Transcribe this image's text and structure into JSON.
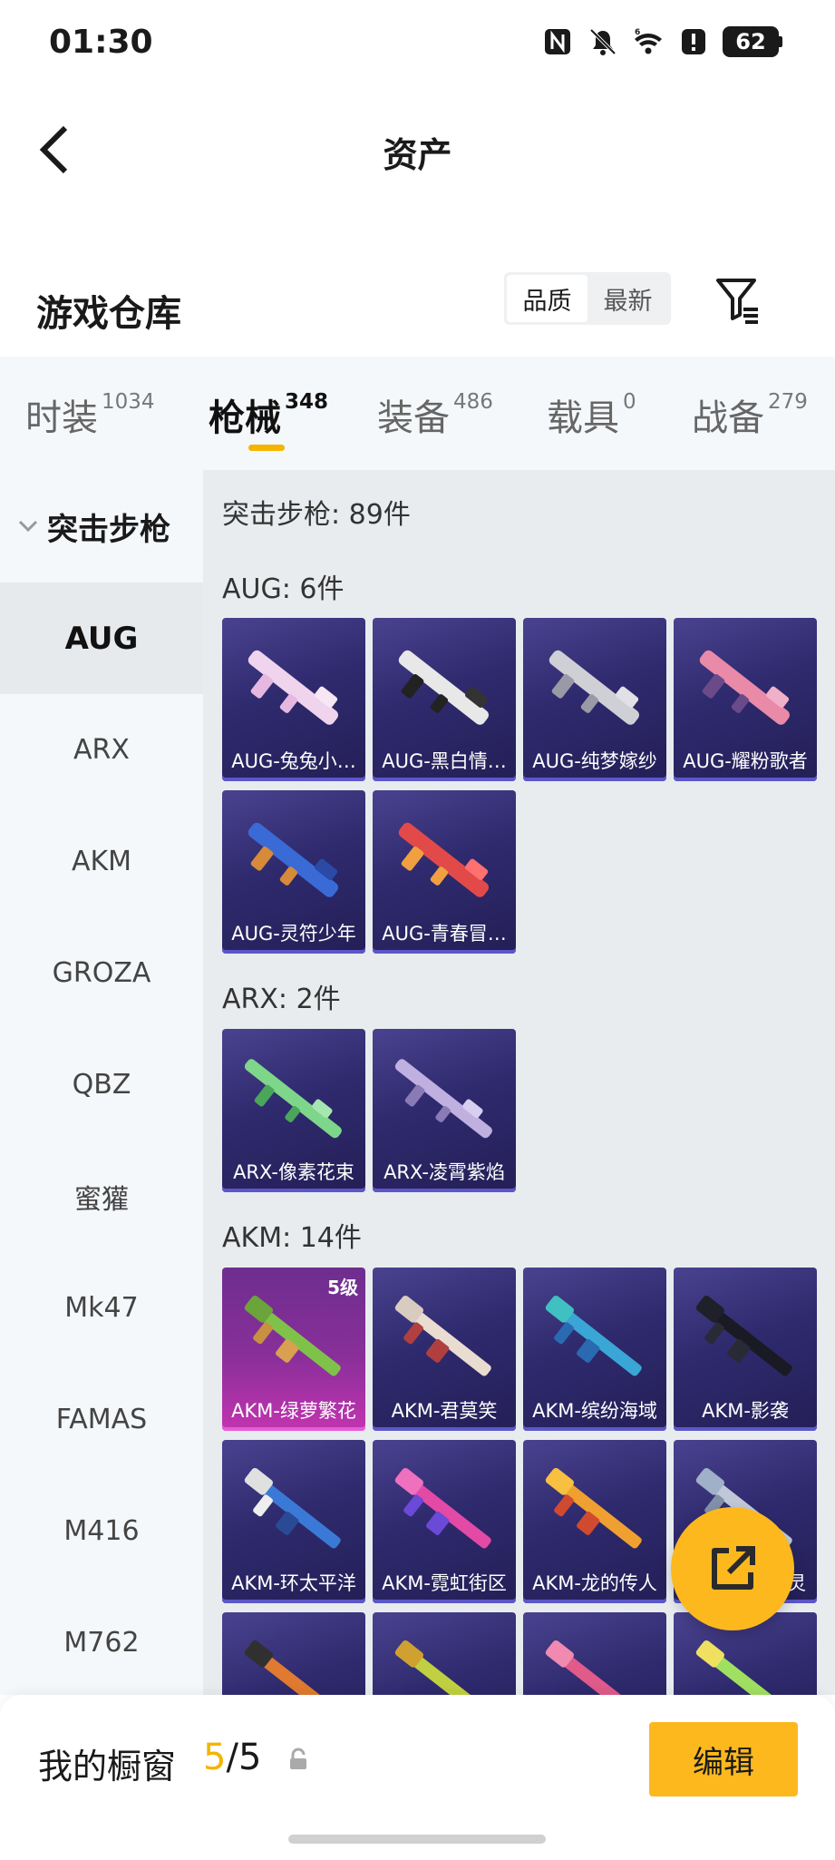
{
  "status": {
    "time": "01:30",
    "icons": [
      "nfc-icon",
      "mute-icon",
      "wifi-6-icon",
      "alert-icon"
    ],
    "battery": "62"
  },
  "nav": {
    "title": "资产",
    "back_icon": "back-arrow-icon"
  },
  "section": {
    "title": "游戏仓库",
    "sort_options": [
      "品质",
      "最新"
    ],
    "sort_selected": "品质",
    "filter_icon": "filter-icon"
  },
  "tabs": [
    {
      "label": "时装",
      "count": "1034"
    },
    {
      "label": "枪械",
      "count": "348",
      "active": true
    },
    {
      "label": "装备",
      "count": "486"
    },
    {
      "label": "载具",
      "count": "0"
    },
    {
      "label": "战备",
      "count": "279"
    }
  ],
  "sidebar": {
    "group_label": "突击步枪",
    "items": [
      "AUG",
      "ARX",
      "AKM",
      "GROZA",
      "QBZ",
      "蜜獾",
      "Mk47",
      "FAMAS",
      "M416",
      "M762"
    ],
    "active": "AUG"
  },
  "main": {
    "summary": "突击步枪: 89件",
    "groups": [
      {
        "label": "AUG: 6件",
        "items": [
          "AUG-兔兔小…",
          "AUG-黑白情…",
          "AUG-纯梦嫁纱",
          "AUG-耀粉歌者",
          "AUG-灵符少年",
          "AUG-青春冒…"
        ]
      },
      {
        "label": "ARX: 2件",
        "items": [
          "ARX-像素花束",
          "ARX-凌霄紫焰"
        ]
      },
      {
        "label": "AKM: 14件",
        "items": [
          "AKM-绿萝繁花",
          "AKM-君莫笑",
          "AKM-缤纷海域",
          "AKM-影袭",
          "AKM-环太平洋",
          "AKM-霓虹街区",
          "AKM-龙的传人",
          "灵"
        ],
        "badge": "5级"
      }
    ]
  },
  "colors": {
    "accent": "#fdb81e",
    "card_dark": "#2f2a6e",
    "card_pink": "#c234b0"
  },
  "bottom": {
    "label": "我的橱窗",
    "current": "5",
    "separator": "/",
    "total": "5",
    "edit_label": "编辑",
    "fab_icon": "share-icon",
    "lock_icon": "lock-icon"
  }
}
